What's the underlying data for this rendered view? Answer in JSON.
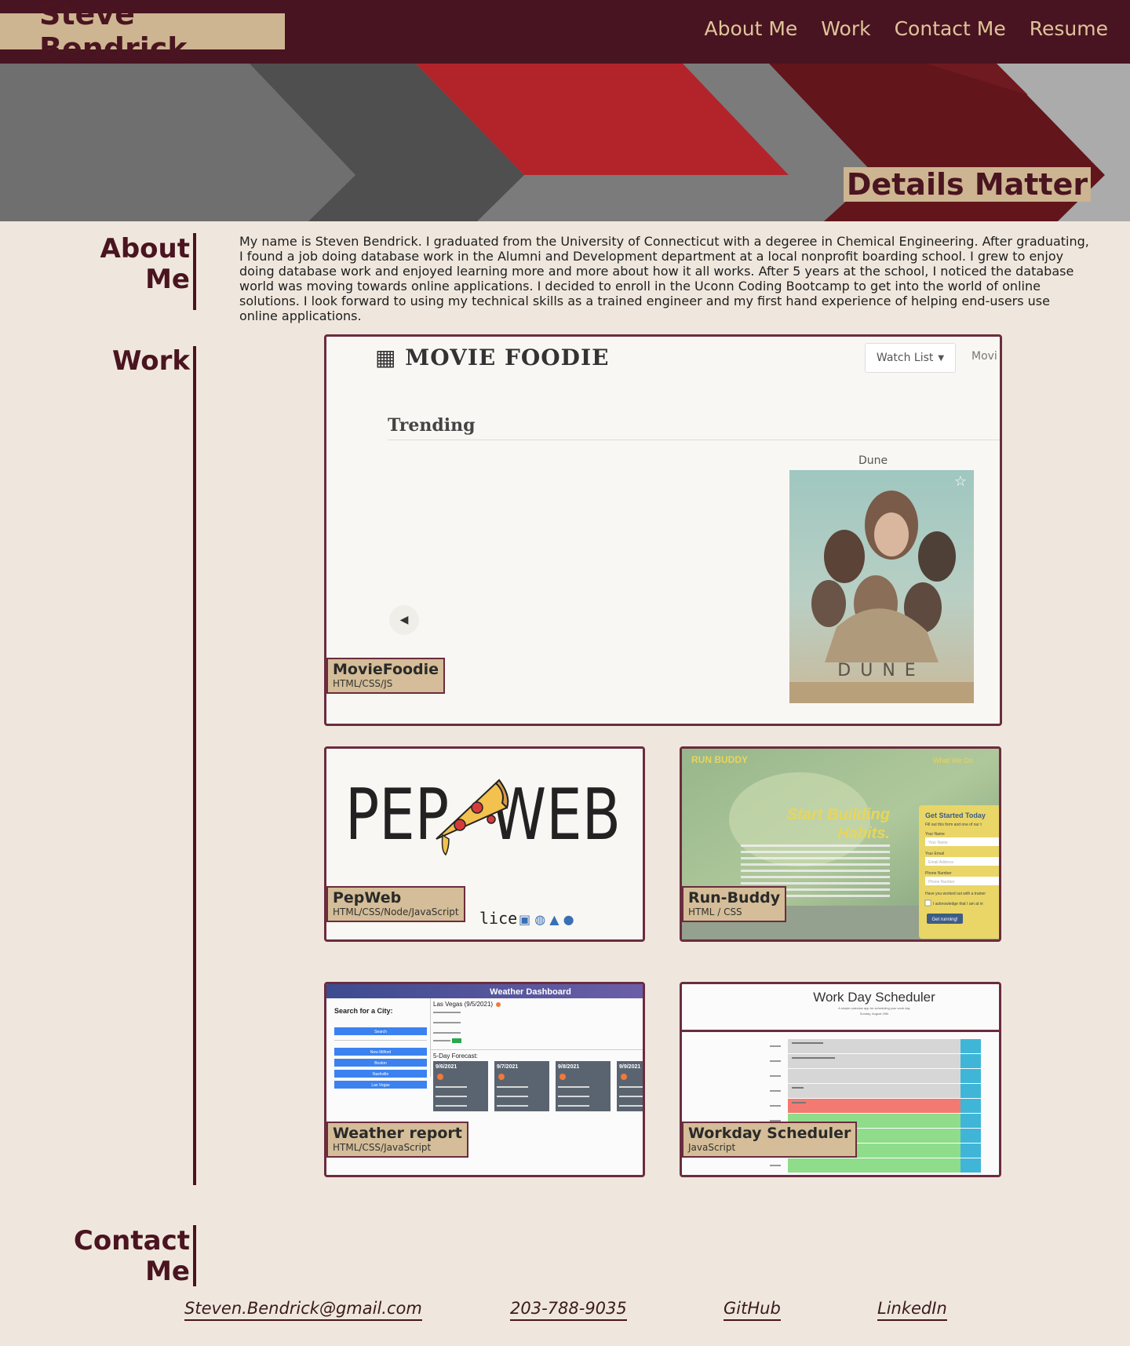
{
  "header": {
    "brand": "Steve Bendrick",
    "nav": [
      "About Me",
      "Work",
      "Contact Me",
      "Resume"
    ]
  },
  "hero": {
    "tagline": "Details Matter"
  },
  "about": {
    "title": "About Me",
    "text": "My name is Steven Bendrick. I graduated from the University of Connecticut with a degeree in Chemical Engineering. After graduating, I found a job doing database work in the Alumni and Development department at a local nonprofit boarding school. I grew to enjoy doing database work and enjoyed learning more and more about how it all works. After 5 years at the school, I noticed the database world was moving towards online applications. I decided to enroll in the Uconn Coding Bootcamp to get into the world of online solutions. I look forward to using my technical skills as a trained engineer and my first hand experience of helping end-users use online applications."
  },
  "work": {
    "title": "Work",
    "projects": [
      {
        "name": "MovieFoodie",
        "tech": "HTML/CSS/JS"
      },
      {
        "name": "PepWeb",
        "tech": "HTML/CSS/Node/JavaScript"
      },
      {
        "name": "Run-Buddy",
        "tech": "HTML / CSS"
      },
      {
        "name": "Weather report",
        "tech": "HTML/CSS/JavaScript"
      },
      {
        "name": "Workday Scheduler",
        "tech": "JavaScript"
      }
    ],
    "previews": {
      "moviefoodie": {
        "logo": "MOVIE FOODIE",
        "watch_list": "Watch List",
        "nav_more": "Movi",
        "trending": "Trending",
        "film": "Dune",
        "poster_word": "DUNE"
      },
      "pepweb": {
        "logo_left": "PEP",
        "logo_right": "WEB",
        "footer_text": "lice"
      },
      "runbuddy": {
        "brand": "RUN BUDDY",
        "nav": "What We Do",
        "headline1": "Start Building",
        "headline2": "Habits.",
        "form_title": "Get Started Today",
        "form_sub": "Fill out this form and one of our t",
        "field1": "Your Name",
        "field1_ph": "Your Name",
        "field2": "Your Email",
        "field2_ph": "Email Address",
        "field3": "Phone Number",
        "field3_ph": "Phone Number",
        "question": "Have you worked out with a trainer",
        "ack": "I acknowledge that I am at in",
        "cta": "Get running!"
      },
      "weather": {
        "title": "Weather Dashboard",
        "search_label": "Search for a City:",
        "search_btn": "Search",
        "cities": [
          "New Milford",
          "Boston",
          "Nashville",
          "Las Vegas"
        ],
        "current": "Las Vegas (9/5/2021)",
        "forecast_label": "5-Day Forecast:",
        "days": [
          "9/6/2021",
          "9/7/2021",
          "9/8/2021",
          "9/9/2021"
        ]
      },
      "scheduler": {
        "title": "Work Day Scheduler",
        "subtitle": "A simple calendar app for scheduling your work day",
        "date": "Sunday, August 29th"
      }
    }
  },
  "contact": {
    "title": "Contact Me",
    "email": "Steven.Bendrick@gmail.com",
    "phone": "203-788-9035",
    "github": "GitHub",
    "linkedin": "LinkedIn"
  },
  "colors": {
    "maroon": "#481421",
    "tan": "#cdb591",
    "cream": "#efe7dd",
    "red": "#b3242a",
    "darkred": "#62151a"
  }
}
